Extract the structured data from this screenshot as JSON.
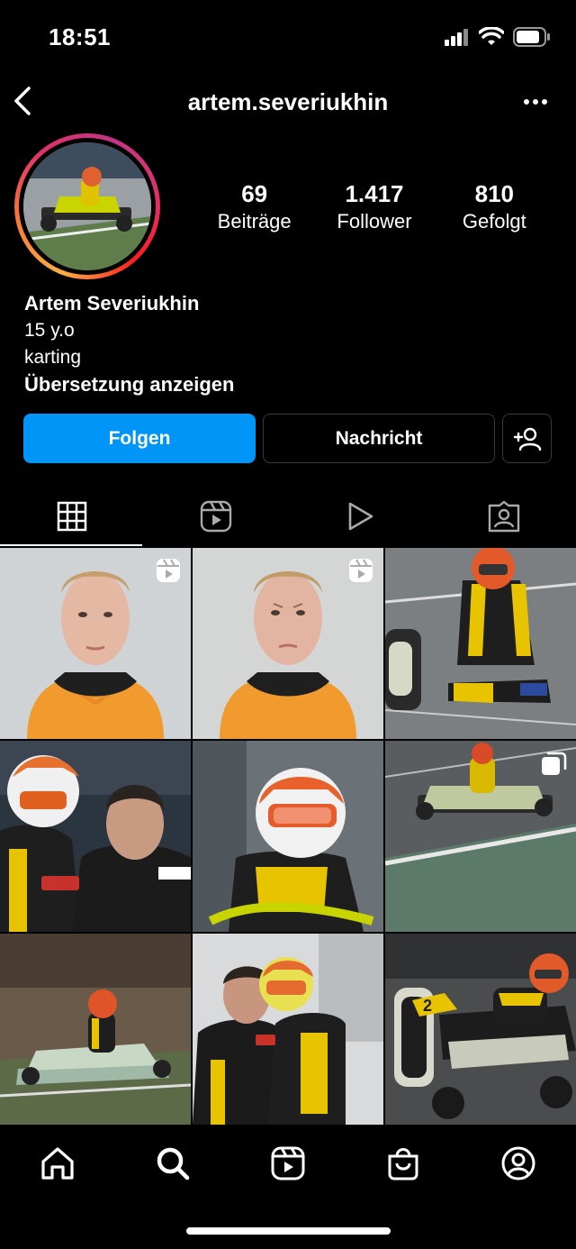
{
  "status_bar": {
    "time": "18:51"
  },
  "header": {
    "username": "artem.severiukhin"
  },
  "stats": [
    {
      "value": "69",
      "label": "Beiträge"
    },
    {
      "value": "1.417",
      "label": "Follower"
    },
    {
      "value": "810",
      "label": "Gefolgt"
    }
  ],
  "bio": {
    "name": "Artem Severiukhin",
    "line1": "15 y.o",
    "line2": "karting",
    "translate": "Übersetzung anzeigen"
  },
  "actions": {
    "follow": "Folgen",
    "message": "Nachricht"
  },
  "colors": {
    "follow_button": "#0095f6",
    "background": "#000000"
  },
  "tabs": [
    "grid-icon",
    "reels-icon",
    "video-icon",
    "tagged-icon"
  ],
  "posts": [
    {
      "description": "portrait orange hoodie",
      "badge": "reels-icon"
    },
    {
      "description": "portrait orange hoodie",
      "badge": "reels-icon"
    },
    {
      "description": "driver sitting on track",
      "badge": ""
    },
    {
      "description": "driver with coach and phone",
      "badge": ""
    },
    {
      "description": "driver in helmet close-up",
      "badge": ""
    },
    {
      "description": "kart on track",
      "badge": "carousel-icon"
    },
    {
      "description": "kart racing action",
      "badge": ""
    },
    {
      "description": "coach and driver looking at phone",
      "badge": ""
    },
    {
      "description": "kart close-up number 2",
      "badge": ""
    }
  ],
  "bottom_nav": [
    "home-icon",
    "search-icon",
    "reels-icon",
    "shop-icon",
    "profile-icon"
  ]
}
